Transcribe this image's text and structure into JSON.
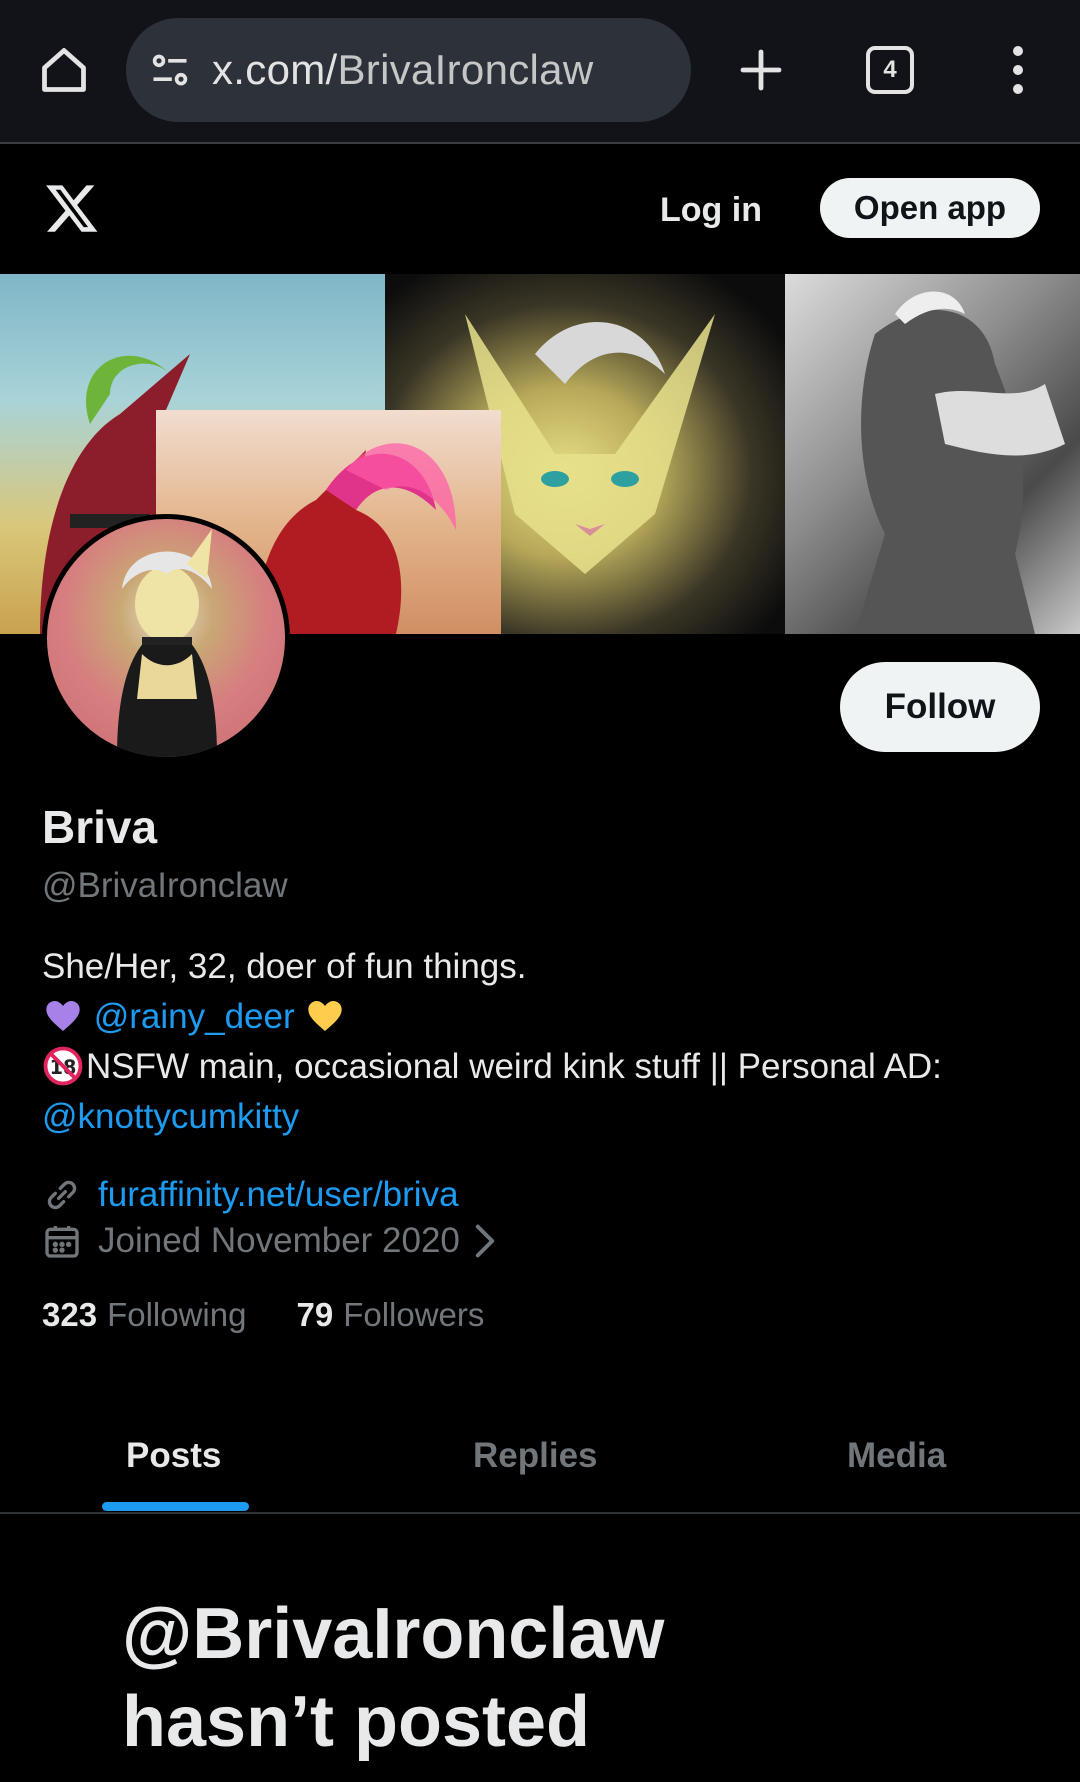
{
  "browser": {
    "url_host": "x.com/",
    "url_path": "BrivaIronclaw",
    "tab_count": "4",
    "icons": [
      "home-icon",
      "site-settings-icon",
      "new-tab-icon",
      "tab-switcher-icon",
      "more-menu-icon"
    ]
  },
  "header": {
    "login_label": "Log in",
    "open_app_label": "Open app"
  },
  "profile": {
    "follow_label": "Follow",
    "display_name": "Briva",
    "handle": "@BrivaIronclaw",
    "bio": {
      "line1": "She/Her, 32, doer of fun things.",
      "partner_link": "@rainy_deer",
      "line3": "NSFW main, occasional weird kink stuff || Personal AD:",
      "ad_link": "@knottycumkitty"
    },
    "website": "furaffinity.net/user/briva",
    "joined": "Joined November 2020",
    "following_count": "323",
    "following_label": "Following",
    "followers_count": "79",
    "followers_label": "Followers"
  },
  "tabs": [
    {
      "label": "Posts",
      "active": true
    },
    {
      "label": "Replies",
      "active": false
    },
    {
      "label": "Media",
      "active": false
    }
  ],
  "empty_state": {
    "title_line1": "@BrivaIronclaw",
    "title_line2": "hasn’t posted"
  },
  "colors": {
    "accent": "#1d9bf0",
    "background": "#000000",
    "muted_text": "#71767b",
    "primary_text": "#e7e9ea"
  }
}
